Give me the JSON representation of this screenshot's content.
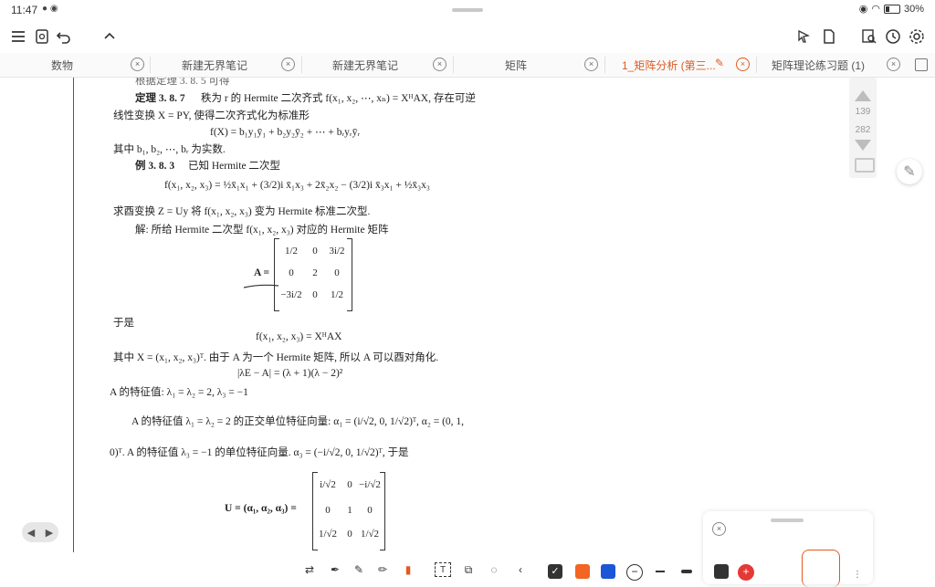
{
  "status_bar": {
    "time": "11:47",
    "battery": "30%",
    "battery_level": 0.3
  },
  "tabs": [
    {
      "label": "数物",
      "active": false
    },
    {
      "label": "新建无界笔记",
      "active": false
    },
    {
      "label": "新建无界笔记",
      "active": false
    },
    {
      "label": "矩阵",
      "active": false
    },
    {
      "label": "1_矩阵分析 (第三...",
      "active": true
    },
    {
      "label": "矩阵理论练习题 (1)",
      "active": false
    }
  ],
  "scroll": {
    "current": "139",
    "total": "282"
  },
  "document": {
    "l0": "根据定理 3. 8. 5 可得",
    "thm_label": "定理 3. 8. 7",
    "thm_text1": "秩为 r 的 Hermite 二次齐式 f(x₁, x₂, ⋯, xₙ) = XᴴAX, 存在可逆",
    "thm_text2": "线性变换 X = PY, 使得二次齐式化为标准形",
    "eq1": "f(X) = b₁y₁ȳ₁ + b₂y₂ȳ₂ + ⋯ + bᵣyᵣȳᵣ",
    "l_b": "其中 b₁, b₂, ⋯, bᵣ 为实数.",
    "ex_label": "例 3. 8. 3",
    "ex_text": "已知 Hermite 二次型",
    "eq2": "f(x₁, x₂, x₃) = ½x̄₁x₁ + (3/2)i x̄₁x₃ + 2x̄₂x₂ − (3/2)i x̄₃x₁ + ½x̄₃x₃",
    "l_ask": "求酉变换 Z = Uy  将 f(x₁, x₂, x₃) 变为 Hermite 标准二次型.",
    "l_sol": "解: 所给 Hermite 二次型 f(x₁, x₂, x₃) 对应的 Hermite 矩阵",
    "A_label": "A =",
    "A_matrix": [
      [
        "1/2",
        "0",
        "3i/2"
      ],
      [
        "0",
        "2",
        "0"
      ],
      [
        "−3i/2",
        "0",
        "1/2"
      ]
    ],
    "l_then": "于是",
    "eq3": "f(x₁, x₂, x₃) = XᴴAX",
    "l_where": "其中  X = (x₁, x₂, x₃)ᵀ. 由于 A 为一个 Hermite 矩阵, 所以 A 可以酉对角化.",
    "eq4": "|λE − A| = (λ + 1)(λ − 2)²",
    "l_eig": "A 的特征值: λ₁ = λ₂ = 2, λ₃ = −1",
    "l_vec1": "A 的特征值 λ₁ = λ₂ = 2 的正交单位特征向量: α₁ = (i/√2, 0, 1/√2)ᵀ, α₂ = (0, 1,",
    "l_vec2": "0)ᵀ. A 的特征值 λ₃ = −1 的单位特征向量.  α₃ = (−i/√2, 0, 1/√2)ᵀ, 于是",
    "U_label": "U = (α₁, α₂, α₃) =",
    "U_matrix": [
      [
        "i/√2",
        "0",
        "−i/√2"
      ],
      [
        "0",
        "1",
        "0"
      ],
      [
        "1/√2",
        "0",
        "1/√2"
      ]
    ]
  },
  "colors": {
    "accent": "#e05a20",
    "swatch_black": "#333333",
    "swatch_orange": "#f26522",
    "swatch_blue": "#1a56d6",
    "add_red": "#e53935"
  }
}
